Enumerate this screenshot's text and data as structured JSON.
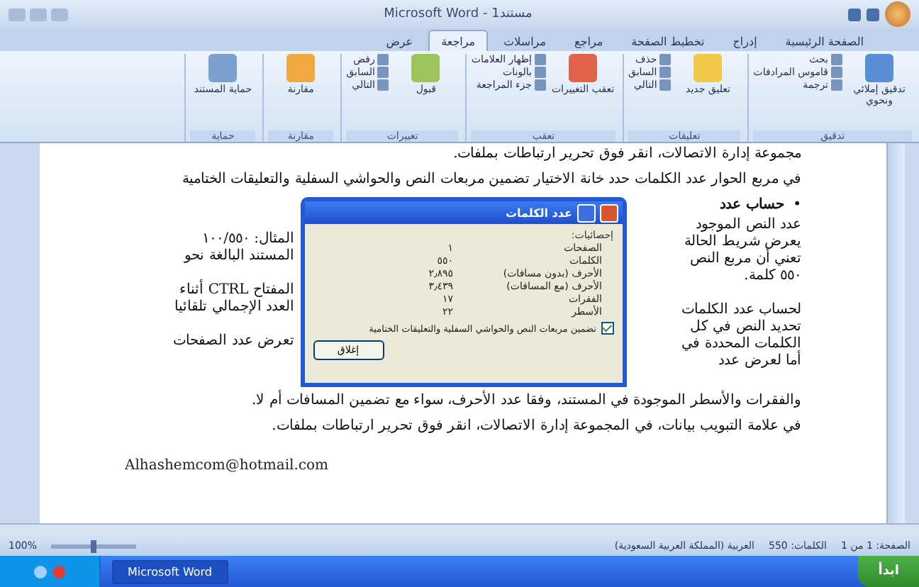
{
  "window": {
    "title": "مستند1 - Microsoft Word"
  },
  "tabs": [
    {
      "label": "الصفحة الرئيسية",
      "selected": false
    },
    {
      "label": "إدراج",
      "selected": false
    },
    {
      "label": "تخطيط الصفحة",
      "selected": false
    },
    {
      "label": "مراجع",
      "selected": false
    },
    {
      "label": "مراسلات",
      "selected": false
    },
    {
      "label": "مراجعة",
      "selected": true
    },
    {
      "label": "عرض",
      "selected": false
    }
  ],
  "ribbon_groups": [
    {
      "label": "تدقيق",
      "big": "تدقيق إملائي ونحوي",
      "small": [
        "بحث",
        "قاموس المرادفات",
        "ترجمة"
      ]
    },
    {
      "label": "تعليقات",
      "big": "تعليق جديد",
      "small": [
        "حذف",
        "السابق",
        "التالي"
      ]
    },
    {
      "label": "تعقب",
      "big": "تعقب التغييرات",
      "small": [
        "إظهار العلامات",
        "بالونات",
        "جزء المراجعة"
      ]
    },
    {
      "label": "تغييرات",
      "big": "قبول",
      "small": [
        "رفض",
        "السابق",
        "التالي"
      ]
    },
    {
      "label": "مقارنة",
      "big": "مقارنة"
    },
    {
      "label": "حماية",
      "big": "حماية المستند"
    }
  ],
  "document": {
    "top_paragraphs": [
      "مجموعة إدارة الاتصالات، انقر فوق تحرير ارتباطات بملفات.",
      "في مربع الحوار عدد الكلمات حدد خانة الاختيار تضمين مربعات النص والحواشي السفلية والتعليقات الختامية"
    ],
    "bullet": {
      "marker": "•",
      "text": "حساب عدد"
    },
    "right_blocks": [
      [
        "عدد النص الموجود",
        "يعرض شريط الحالة",
        "تعني أن مربع النص",
        "٥٥٠ كلمة."
      ],
      [
        "لحساب عدد الكلمات",
        "تحديد النص في كل",
        "الكلمات المحددة في",
        "أما لعرض عدد"
      ]
    ],
    "left_blocks": [
      [
        "المثال: ١٠٠/٥٥٠",
        "المستند البالغة نحو"
      ],
      [
        "المفتاح CTRL أثناء",
        "العدد الإجمالي تلقائيا"
      ],
      [
        "تعرض عدد الصفحات"
      ]
    ],
    "bottom_paragraphs": [
      "والفقرات والأسطر الموجودة في المستند، وفقا عدد الأحرف، سواء مع تضمين المسافات أم لا.",
      "في علامة التبويب بيانات، في المجموعة إدارة الاتصالات، انقر فوق تحرير ارتباطات بملفات."
    ],
    "email": "Alhashemcom@hotmail.com"
  },
  "dialog": {
    "title": "عدد الكلمات",
    "section": "إحصائيات:",
    "stats": [
      {
        "label": "الصفحات",
        "value": "١"
      },
      {
        "label": "الكلمات",
        "value": "٥٥٠"
      },
      {
        "label": "الأحرف (بدون مسافات)",
        "value": "٢٫٨٩٥"
      },
      {
        "label": "الأحرف (مع المسافات)",
        "value": "٣٫٤٣٩"
      },
      {
        "label": "الفقرات",
        "value": "١٧"
      },
      {
        "label": "الأسطر",
        "value": "٢٢"
      }
    ],
    "checkbox": {
      "label": "تضمين مربعات النص والحواشي السفلية والتعليقات الختامية",
      "checked": true
    },
    "button": "إغلاق"
  },
  "status_bar": {
    "items": [
      "الصفحة: 1 من 1",
      "الكلمات: 550",
      "العربية (المملكة العربية السعودية)"
    ],
    "zoom": "100%",
    "zoom_slider": {
      "level": 0.5
    }
  },
  "taskbar": {
    "start": "ابدأ",
    "task": "Microsoft Word"
  }
}
